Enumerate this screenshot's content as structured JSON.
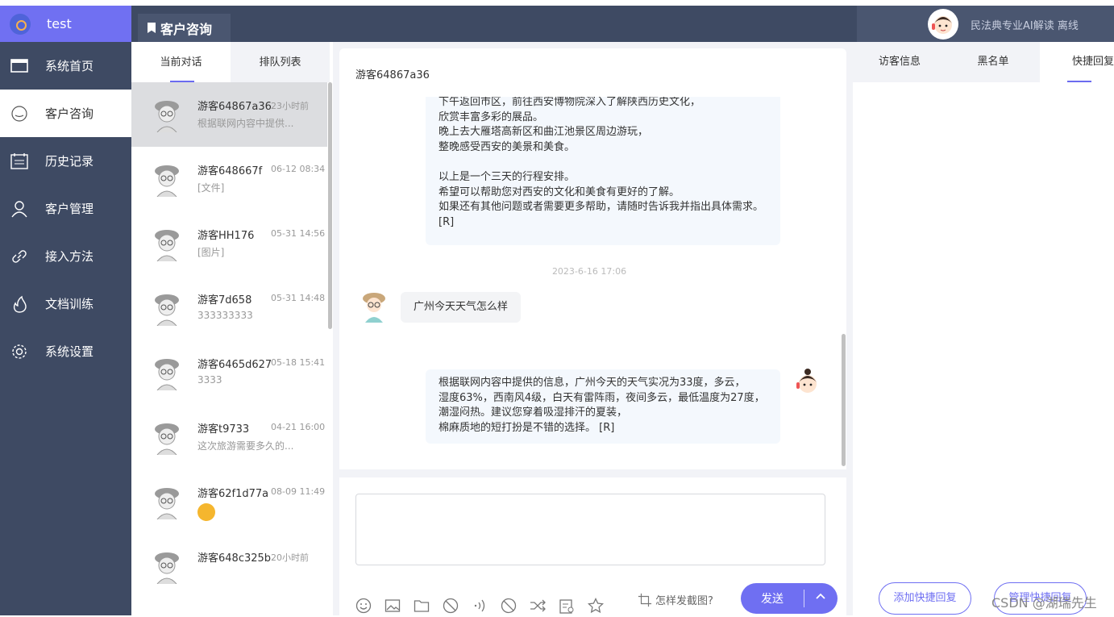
{
  "brand": {
    "name": "test"
  },
  "sidebar": {
    "items": [
      {
        "label": "系统首页",
        "icon": "monitor-icon"
      },
      {
        "label": "客户咨询",
        "icon": "chat-bubble-icon"
      },
      {
        "label": "历史记录",
        "icon": "calendar-list-icon"
      },
      {
        "label": "客户管理",
        "icon": "user-icon"
      },
      {
        "label": "接入方法",
        "icon": "link-icon"
      },
      {
        "label": "文档训练",
        "icon": "flame-icon"
      },
      {
        "label": "系统设置",
        "icon": "gear-icon"
      }
    ]
  },
  "header": {
    "title": "客户咨询",
    "user_status": "民法典专业AI解读 离线"
  },
  "conv_tabs": {
    "current": "当前对话",
    "queue": "排队列表"
  },
  "conversations": [
    {
      "name": "游客64867a36",
      "time": "23小时前",
      "preview": "根据联网内容中提供..."
    },
    {
      "name": "游客648667f",
      "time": "06-12 08:34",
      "preview": "[文件]"
    },
    {
      "name": "游客HH176",
      "time": "05-31 14:56",
      "preview": "[图片]"
    },
    {
      "name": "游客7d658",
      "time": "05-31 14:48",
      "preview": "333333333"
    },
    {
      "name": "游客6465d627",
      "time": "05-18 15:41",
      "preview": "3333"
    },
    {
      "name": "游客t9733",
      "time": "04-21 16:00",
      "preview": "这次旅游需要多久的..."
    },
    {
      "name": "游客62f1d77a",
      "time": "08-09 11:49",
      "preview": ""
    },
    {
      "name": "游客648c325b",
      "time": "20小时前",
      "preview": ""
    }
  ],
  "chat": {
    "visitor": "游客64867a36",
    "msg1_lines": [
      "下午返回市区，前往西安博物院深入了解陕西历史文化，",
      "欣赏丰富多彩的展品。",
      "晚上去大雁塔高新区和曲江池景区周边游玩，",
      "整晚感受西安的美景和美食。",
      "",
      "以上是一个三天的行程安排。",
      "希望可以帮助您对西安的文化和美食有更好的了解。",
      "如果还有其他问题或者需要更多帮助，请随时告诉我并指出具体需求。",
      "[R]"
    ],
    "timestamp": "2023-6-16 17:06",
    "msg2": "广州今天天气怎么样",
    "msg3_lines": [
      "根据联网内容中提供的信息，广州今天的天气实况为33度，多云，",
      "湿度63%，西南风4级，白天有雷阵雨，夜间多云，最低温度为27度，",
      "潮湿闷热。建议您穿着吸湿排汗的夏装，",
      "棉麻质地的短打扮是不错的选择。 [R]"
    ]
  },
  "composer": {
    "screenshot_tip": "怎样发截图?",
    "send_label": "发送",
    "tools": [
      "emoji-icon",
      "image-icon",
      "folder-icon",
      "ban-icon",
      "voice-icon",
      "block-icon",
      "transfer-icon",
      "invite-icon",
      "star-icon"
    ]
  },
  "right_panel": {
    "tabs": [
      "访客信息",
      "黑名单",
      "快捷回复"
    ],
    "add_quick_reply": "添加快捷回复",
    "manage_quick_reply": "管理快捷回复"
  },
  "watermark": "CSDN @湖瑞先生"
}
